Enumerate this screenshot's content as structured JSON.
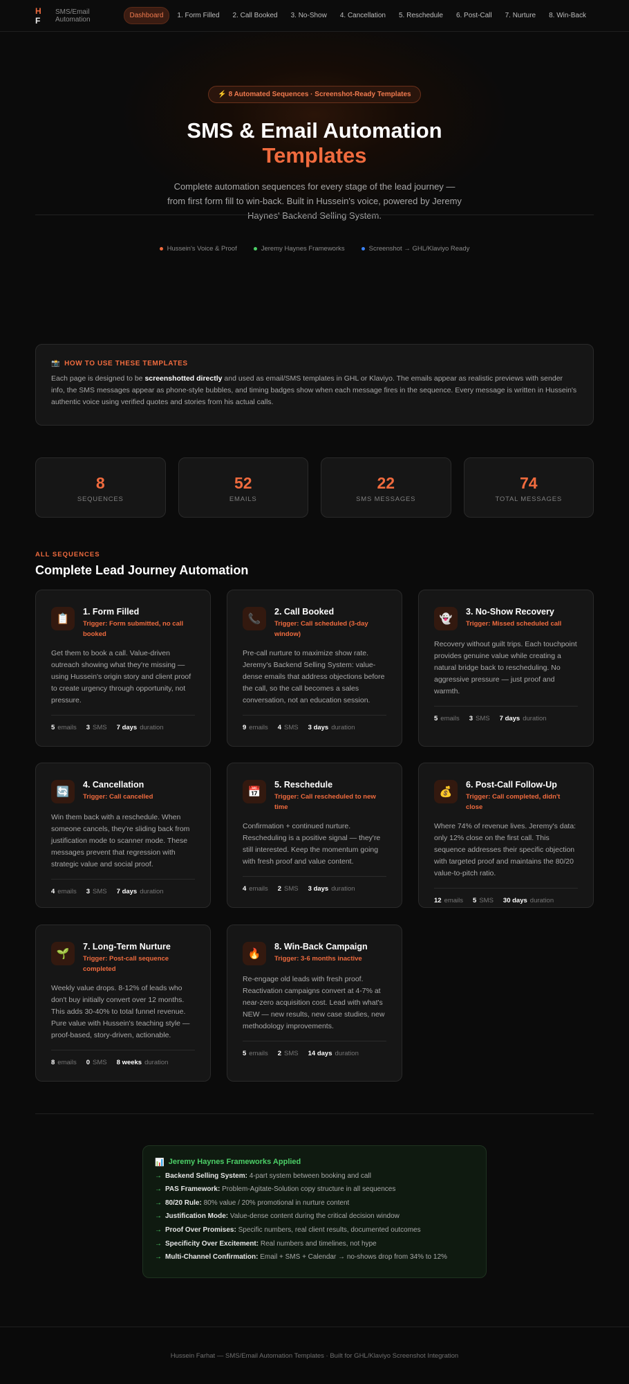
{
  "nav": {
    "logo_h": "H",
    "logo_f": "F",
    "brand_sub": "SMS/Email Automation",
    "items": [
      "Dashboard",
      "1. Form Filled",
      "2. Call Booked",
      "3. No-Show",
      "4. Cancellation",
      "5. Reschedule",
      "6. Post-Call",
      "7. Nurture",
      "8. Win-Back"
    ]
  },
  "hero": {
    "pill": "⚡ 8 Automated Sequences · Screenshot-Ready Templates",
    "title_line1": "SMS & Email Automation",
    "title_line2": "Templates",
    "lead": "Complete automation sequences for every stage of the lead journey — from first form fill to win-back. Built in Hussein's voice, powered by Jeremy Haynes' Backend Selling System.",
    "chips": [
      {
        "label": "Hussein's Voice & Proof",
        "color": "#f06b3e"
      },
      {
        "label": "Jeremy Haynes Frameworks",
        "color": "#4ccf67"
      },
      {
        "label": "Screenshot → GHL/Klaviyo Ready",
        "color": "#3b82f6"
      }
    ]
  },
  "howto": {
    "icon": "📸",
    "title": "HOW TO USE THESE TEMPLATES",
    "body_pre": "Each page is designed to be ",
    "body_bold": "screenshotted directly",
    "body_post": " and used as email/SMS templates in GHL or Klaviyo. The emails appear as realistic previews with sender info, the SMS messages appear as phone-style bubbles, and timing badges show when each message fires in the sequence. Every message is written in Hussein's authentic voice using verified quotes and stories from his actual calls."
  },
  "stats": [
    {
      "value": "8",
      "label": "SEQUENCES"
    },
    {
      "value": "52",
      "label": "EMAILS"
    },
    {
      "value": "22",
      "label": "SMS MESSAGES"
    },
    {
      "value": "74",
      "label": "TOTAL MESSAGES"
    }
  ],
  "section": {
    "kicker": "ALL SEQUENCES",
    "title": "Complete Lead Journey Automation"
  },
  "cards": [
    {
      "icon": "📋",
      "title": "1. Form Filled",
      "trigger": "Trigger: Form submitted, no call booked",
      "desc": "Get them to book a call. Value-driven outreach showing what they're missing — using Hussein's origin story and client proof to create urgency through opportunity, not pressure.",
      "emails": "5",
      "sms": "3",
      "duration": "7 days"
    },
    {
      "icon": "📞",
      "title": "2. Call Booked",
      "trigger": "Trigger: Call scheduled (3-day window)",
      "desc": "Pre-call nurture to maximize show rate. Jeremy's Backend Selling System: value-dense emails that address objections before the call, so the call becomes a sales conversation, not an education session.",
      "emails": "9",
      "sms": "4",
      "duration": "3 days"
    },
    {
      "icon": "👻",
      "title": "3. No-Show Recovery",
      "trigger": "Trigger: Missed scheduled call",
      "desc": "Recovery without guilt trips. Each touchpoint provides genuine value while creating a natural bridge back to rescheduling. No aggressive pressure — just proof and warmth.",
      "emails": "5",
      "sms": "3",
      "duration": "7 days"
    },
    {
      "icon": "🔄",
      "title": "4. Cancellation",
      "trigger": "Trigger: Call cancelled",
      "desc": "Win them back with a reschedule. When someone cancels, they're sliding back from justification mode to scanner mode. These messages prevent that regression with strategic value and social proof.",
      "emails": "4",
      "sms": "3",
      "duration": "7 days"
    },
    {
      "icon": "📅",
      "title": "5. Reschedule",
      "trigger": "Trigger: Call rescheduled to new time",
      "desc": "Confirmation + continued nurture. Rescheduling is a positive signal — they're still interested. Keep the momentum going with fresh proof and value content.",
      "emails": "4",
      "sms": "2",
      "duration": "3 days"
    },
    {
      "icon": "💰",
      "title": "6. Post-Call Follow-Up",
      "trigger": "Trigger: Call completed, didn't close",
      "desc": "Where 74% of revenue lives. Jeremy's data: only 12% close on the first call. This sequence addresses their specific objection with targeted proof and maintains the 80/20 value-to-pitch ratio.",
      "emails": "12",
      "sms": "5",
      "duration": "30 days"
    },
    {
      "icon": "🌱",
      "title": "7. Long-Term Nurture",
      "trigger": "Trigger: Post-call sequence completed",
      "desc": "Weekly value drops. 8-12% of leads who don't buy initially convert over 12 months. This adds 30-40% to total funnel revenue. Pure value with Hussein's teaching style — proof-based, story-driven, actionable.",
      "emails": "8",
      "sms": "0",
      "duration": "8 weeks"
    },
    {
      "icon": "🔥",
      "title": "8. Win-Back Campaign",
      "trigger": "Trigger: 3-6 months inactive",
      "desc": "Re-engage old leads with fresh proof. Reactivation campaigns convert at 4-7% at near-zero acquisition cost. Lead with what's NEW — new results, new case studies, new methodology improvements.",
      "emails": "5",
      "sms": "2",
      "duration": "14 days"
    }
  ],
  "meta_labels": {
    "emails": "emails",
    "sms": "SMS",
    "duration": "duration"
  },
  "frameworks": {
    "icon": "📊",
    "title": "Jeremy Haynes Frameworks Applied",
    "items": [
      {
        "bold": "Backend Selling System:",
        "text": "4-part system between booking and call"
      },
      {
        "bold": "PAS Framework:",
        "text": "Problem-Agitate-Solution copy structure in all sequences"
      },
      {
        "bold": "80/20 Rule:",
        "text": "80% value / 20% promotional in nurture content"
      },
      {
        "bold": "Justification Mode:",
        "text": "Value-dense content during the critical decision window"
      },
      {
        "bold": "Proof Over Promises:",
        "text": "Specific numbers, real client results, documented outcomes"
      },
      {
        "bold": "Specificity Over Excitement:",
        "text": "Real numbers and timelines, not hype"
      },
      {
        "bold": "Multi-Channel Confirmation:",
        "text": "Email + SMS + Calendar → no-shows drop from 34% to 12%"
      }
    ]
  },
  "footer": "Hussein Farhat — SMS/Email Automation Templates · Built for GHL/Klaviyo Screenshot Integration"
}
